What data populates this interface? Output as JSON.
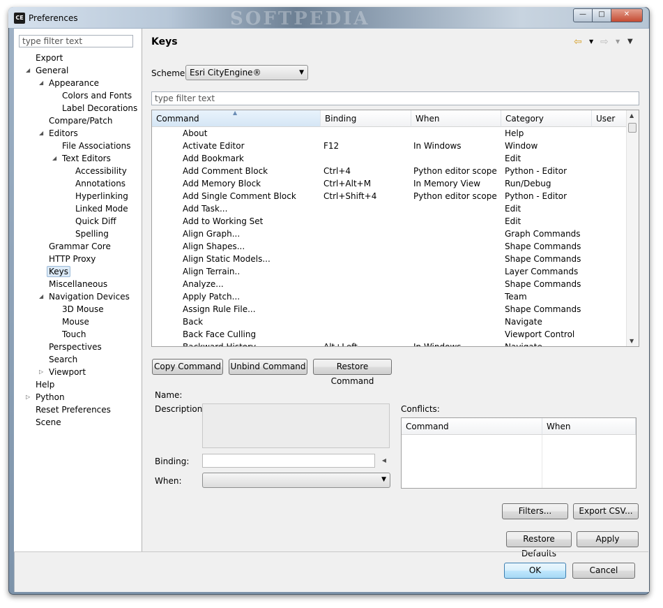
{
  "window": {
    "title": "Preferences",
    "icon": "CE",
    "watermark": "SOFTPEDIA"
  },
  "tree": {
    "filter_placeholder": "type filter text",
    "items": [
      {
        "label": "Export",
        "level": 0,
        "expander": ""
      },
      {
        "label": "General",
        "level": 0,
        "expander": "expanded"
      },
      {
        "label": "Appearance",
        "level": 1,
        "expander": "expanded"
      },
      {
        "label": "Colors and Fonts",
        "level": 2,
        "expander": ""
      },
      {
        "label": "Label Decorations",
        "level": 2,
        "expander": ""
      },
      {
        "label": "Compare/Patch",
        "level": 1,
        "expander": ""
      },
      {
        "label": "Editors",
        "level": 1,
        "expander": "expanded"
      },
      {
        "label": "File Associations",
        "level": 2,
        "expander": ""
      },
      {
        "label": "Text Editors",
        "level": 2,
        "expander": "expanded"
      },
      {
        "label": "Accessibility",
        "level": 3,
        "expander": ""
      },
      {
        "label": "Annotations",
        "level": 3,
        "expander": ""
      },
      {
        "label": "Hyperlinking",
        "level": 3,
        "expander": ""
      },
      {
        "label": "Linked Mode",
        "level": 3,
        "expander": ""
      },
      {
        "label": "Quick Diff",
        "level": 3,
        "expander": ""
      },
      {
        "label": "Spelling",
        "level": 3,
        "expander": ""
      },
      {
        "label": "Grammar Core",
        "level": 1,
        "expander": ""
      },
      {
        "label": "HTTP Proxy",
        "level": 1,
        "expander": ""
      },
      {
        "label": "Keys",
        "level": 1,
        "expander": "",
        "selected": true
      },
      {
        "label": "Miscellaneous",
        "level": 1,
        "expander": ""
      },
      {
        "label": "Navigation Devices",
        "level": 1,
        "expander": "expanded"
      },
      {
        "label": "3D Mouse",
        "level": 2,
        "expander": ""
      },
      {
        "label": "Mouse",
        "level": 2,
        "expander": ""
      },
      {
        "label": "Touch",
        "level": 2,
        "expander": ""
      },
      {
        "label": "Perspectives",
        "level": 1,
        "expander": ""
      },
      {
        "label": "Search",
        "level": 1,
        "expander": ""
      },
      {
        "label": "Viewport",
        "level": 1,
        "expander": "collapsed"
      },
      {
        "label": "Help",
        "level": 0,
        "expander": ""
      },
      {
        "label": "Python",
        "level": 0,
        "expander": "collapsed"
      },
      {
        "label": "Reset Preferences",
        "level": 0,
        "expander": ""
      },
      {
        "label": "Scene",
        "level": 0,
        "expander": ""
      }
    ]
  },
  "page": {
    "title": "Keys",
    "scheme_label": "Scheme:",
    "scheme_value": "Esri CityEngine®",
    "filter_placeholder": "type filter text"
  },
  "table": {
    "columns": [
      "Command",
      "Binding",
      "When",
      "Category",
      "User"
    ],
    "rows": [
      [
        "About",
        "",
        "",
        "Help"
      ],
      [
        "Activate Editor",
        "F12",
        "In Windows",
        "Window"
      ],
      [
        "Add Bookmark",
        "",
        "",
        "Edit"
      ],
      [
        "Add Comment Block",
        "Ctrl+4",
        "Python editor scope",
        "Python - Editor"
      ],
      [
        "Add Memory Block",
        "Ctrl+Alt+M",
        "In Memory View",
        "Run/Debug"
      ],
      [
        "Add Single Comment Block",
        "Ctrl+Shift+4",
        "Python editor scope",
        "Python - Editor"
      ],
      [
        "Add Task...",
        "",
        "",
        "Edit"
      ],
      [
        "Add to Working Set",
        "",
        "",
        "Edit"
      ],
      [
        "Align Graph...",
        "",
        "",
        "Graph Commands"
      ],
      [
        "Align Shapes...",
        "",
        "",
        "Shape Commands"
      ],
      [
        "Align Static Models...",
        "",
        "",
        "Shape Commands"
      ],
      [
        "Align Terrain..",
        "",
        "",
        "Layer Commands"
      ],
      [
        "Analyze...",
        "",
        "",
        "Shape Commands"
      ],
      [
        "Apply Patch...",
        "",
        "",
        "Team"
      ],
      [
        "Assign Rule File...",
        "",
        "",
        "Shape Commands"
      ],
      [
        "Back",
        "",
        "",
        "Navigate"
      ],
      [
        "Back Face Culling",
        "",
        "",
        "Viewport Control"
      ],
      [
        "Backward History",
        "Alt+Left",
        "In Windows",
        "Navigate"
      ]
    ]
  },
  "buttons": {
    "copy": "Copy Command",
    "unbind": "Unbind Command",
    "restore": "Restore Command",
    "filters": "Filters...",
    "export_csv": "Export CSV...",
    "restore_defaults": "Restore Defaults",
    "apply": "Apply",
    "ok": "OK",
    "cancel": "Cancel"
  },
  "details": {
    "name_label": "Name:",
    "description_label": "Description:",
    "binding_label": "Binding:",
    "when_label": "When:",
    "conflicts_label": "Conflicts:",
    "conflict_columns": [
      "Command",
      "When"
    ]
  }
}
